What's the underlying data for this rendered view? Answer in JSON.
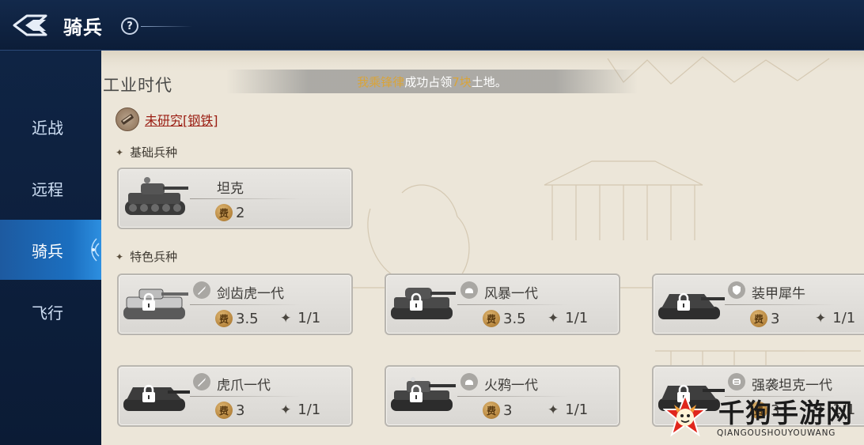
{
  "header": {
    "title": "骑兵",
    "help_label": "?",
    "back_icon": "back-arrow-icon"
  },
  "sidebar": {
    "items": [
      {
        "label": "近战",
        "active": false
      },
      {
        "label": "远程",
        "active": false
      },
      {
        "label": "骑兵",
        "active": true
      },
      {
        "label": "飞行",
        "active": false
      }
    ]
  },
  "content": {
    "era_title": "工业时代",
    "notice": {
      "name": "我乘锋律",
      "middle": "成功占领",
      "count": "7块",
      "end": "土地。"
    },
    "research": {
      "label": "未研究[钢铁]",
      "icon": "steel-ingot-icon"
    },
    "basic_section": {
      "label": "基础兵种",
      "units": [
        {
          "name": "坦克",
          "cost": "2",
          "cost_icon_label": "费",
          "locked": false
        }
      ]
    },
    "special_section": {
      "label": "特色兵种",
      "units": [
        {
          "name": "剑齿虎一代",
          "cost": "3.5",
          "limit": "1/1",
          "type_icon": "sword-icon",
          "locked": true
        },
        {
          "name": "风暴一代",
          "cost": "3.5",
          "limit": "1/1",
          "type_icon": "helmet-icon",
          "locked": true
        },
        {
          "name": "装甲犀牛",
          "cost": "3",
          "limit": "1/1",
          "type_icon": "shield-icon",
          "locked": true
        },
        {
          "name": "虎爪一代",
          "cost": "3",
          "limit": "1/1",
          "type_icon": "sword-icon",
          "locked": true
        },
        {
          "name": "火鸦一代",
          "cost": "3",
          "limit": "1/1",
          "type_icon": "helmet-icon",
          "locked": true
        },
        {
          "name": "强袭坦克一代",
          "cost": "3",
          "limit": "1/1",
          "type_icon": "horn-icon",
          "locked": true
        }
      ]
    },
    "cost_icon_label": "费"
  },
  "watermark": {
    "text": "千狗手游网",
    "sub": "QIANGOUSHOUYOUWANG"
  },
  "colors": {
    "sidebar_active": "#1b6fc0",
    "topbar": "#13294b",
    "parchment": "#ece6d9",
    "research_link": "#9a1d12",
    "notice_gold": "#d9a43a"
  }
}
